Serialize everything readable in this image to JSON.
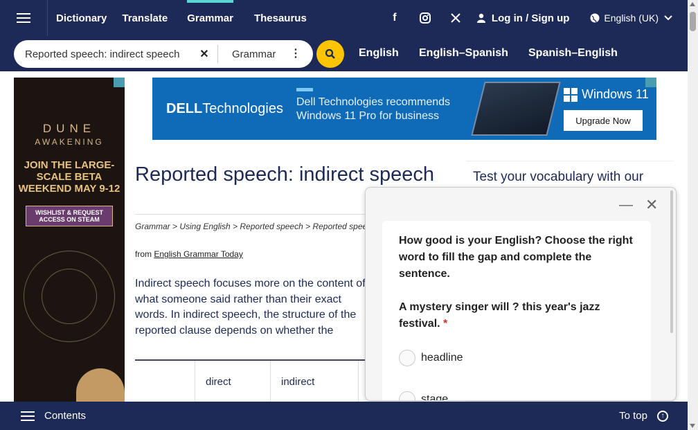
{
  "nav": {
    "links": [
      "Dictionary",
      "Translate",
      "Grammar",
      "Thesaurus"
    ],
    "active": "Grammar",
    "social": [
      "facebook-icon",
      "instagram-icon",
      "x-icon"
    ],
    "login": "Log in / Sign up",
    "language": "English (UK)"
  },
  "search": {
    "value": "Reported speech: indirect speech",
    "dictionary": "Grammar",
    "dict_links": [
      "English",
      "English–Spanish",
      "Spanish–English"
    ]
  },
  "left_ad": {
    "line1": "DUNE",
    "line2": "AWAKENING",
    "headline": "JOIN THE LARGE-SCALE BETA WEEKEND MAY 9-12",
    "cta": "WISHLIST & REQUEST ACCESS ON STEAM"
  },
  "banner": {
    "brand": "DELL",
    "brand2": "Technologies",
    "text1": "Dell Technologies recommends",
    "text2": "Windows 11 Pro for business",
    "product": "Windows 11",
    "cta": "Upgrade Now"
  },
  "article": {
    "title": "Reported speech: indirect speech",
    "breadcrumb": "Grammar > Using English > Reported speech > Reported speech: indirect speech",
    "from_prefix": "from ",
    "from_link": "English Grammar Today",
    "paragraph": "Indirect speech focuses more on the content of what someone said rather than their exact words. In indirect speech, the structure of the reported clause depends on whether the speaker is reporting a statement, a question or a command.",
    "table_headers": [
      "direct",
      "indirect"
    ]
  },
  "sidebar": {
    "vocab_title": "Test your vocabulary with our"
  },
  "quiz": {
    "question": "How good is your English? Choose the right word to fill the gap and complete the sentence.",
    "sentence": "A mystery singer will ? this year's jazz festival.",
    "required_mark": "*",
    "options": [
      "headline",
      "stage"
    ]
  },
  "bottom": {
    "contents": "Contents",
    "to_top": "To top"
  }
}
